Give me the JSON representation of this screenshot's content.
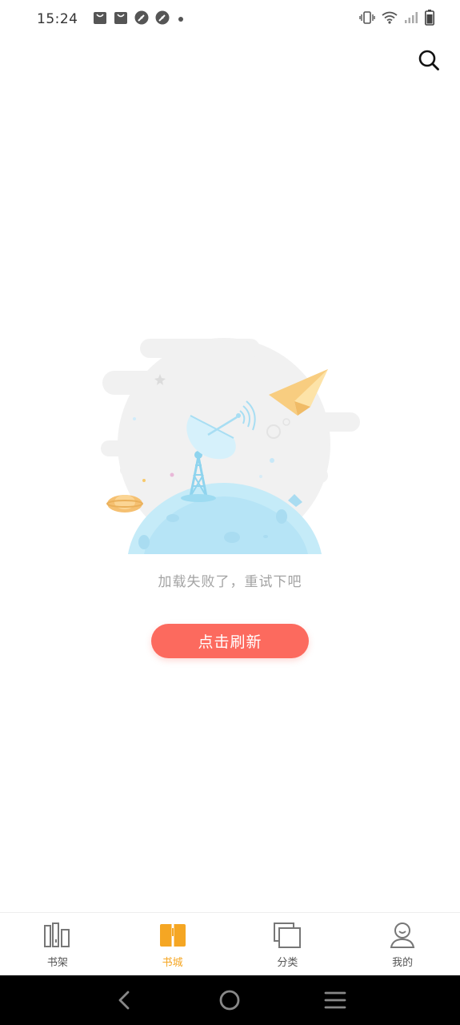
{
  "status_bar": {
    "time": "15:24",
    "notification_icons": [
      "shopping-bag-icon",
      "shopping-bag-icon",
      "compass-icon",
      "compass-icon",
      "dot-icon"
    ],
    "right_icons": [
      "vibrate-icon",
      "wifi-icon",
      "signal-icon",
      "battery-icon"
    ]
  },
  "header": {
    "search_icon": "search-icon"
  },
  "empty_state": {
    "illustration": "satellite-dish-planet-illustration",
    "message": "加载失败了，重试下吧",
    "button_label": "点击刷新"
  },
  "tabs": [
    {
      "label": "书架",
      "icon": "bookshelf-icon",
      "active": false
    },
    {
      "label": "书城",
      "icon": "book-open-icon",
      "active": true
    },
    {
      "label": "分类",
      "icon": "category-icon",
      "active": false
    },
    {
      "label": "我的",
      "icon": "profile-icon",
      "active": false
    }
  ],
  "nav_bar": {
    "buttons": [
      "back-icon",
      "home-icon",
      "menu-icon"
    ]
  },
  "colors": {
    "accent": "#f5a623",
    "button": "#fc6a5e",
    "message_text": "#a3a3a3"
  }
}
